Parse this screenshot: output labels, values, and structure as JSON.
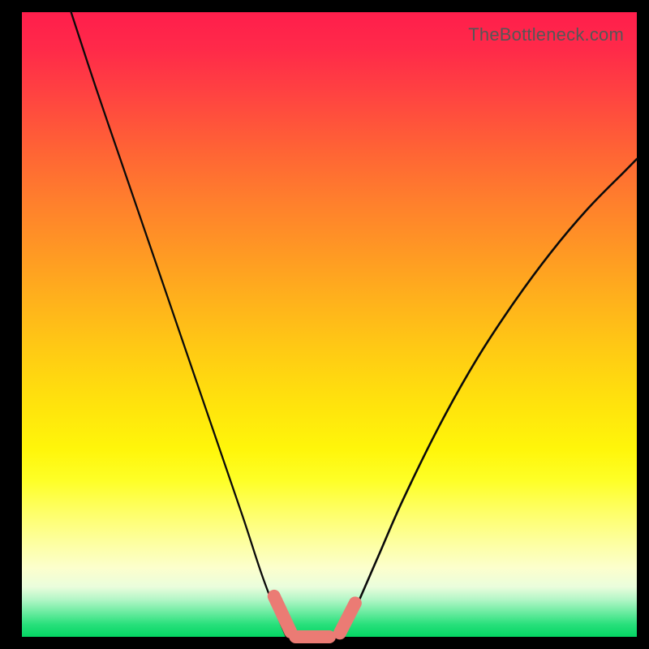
{
  "watermark": "TheBottleneck.com",
  "colors": {
    "mark": "#eb7b74",
    "curve": "#0a0a0a"
  },
  "chart_data": {
    "type": "line",
    "title": "",
    "xlabel": "",
    "ylabel": "",
    "xlim": [
      0,
      100
    ],
    "ylim": [
      0,
      100
    ],
    "series": [
      {
        "name": "left-curve",
        "x": [
          8,
          12,
          16,
          20,
          24,
          28,
          32,
          36,
          39,
          41.5,
          43
        ],
        "y": [
          100,
          88,
          76.5,
          65,
          53.5,
          42,
          30.5,
          19,
          10,
          3.5,
          0
        ]
      },
      {
        "name": "right-curve",
        "x": [
          52,
          54,
          58,
          62,
          68,
          74,
          80,
          86,
          92,
          98,
          100
        ],
        "y": [
          0,
          4,
          13,
          22,
          34,
          44.5,
          53.5,
          61.5,
          68.5,
          74.5,
          76.5
        ]
      }
    ],
    "marks": [
      {
        "name": "left-dash",
        "x0": 41.0,
        "y0": 6.5,
        "x1": 43.7,
        "y1": 0.8
      },
      {
        "name": "bottom-dash",
        "x0": 44.5,
        "y0": 0.0,
        "x1": 50.0,
        "y1": 0.0
      },
      {
        "name": "right-dash",
        "x0": 51.7,
        "y0": 0.6,
        "x1": 54.2,
        "y1": 5.4
      }
    ]
  }
}
